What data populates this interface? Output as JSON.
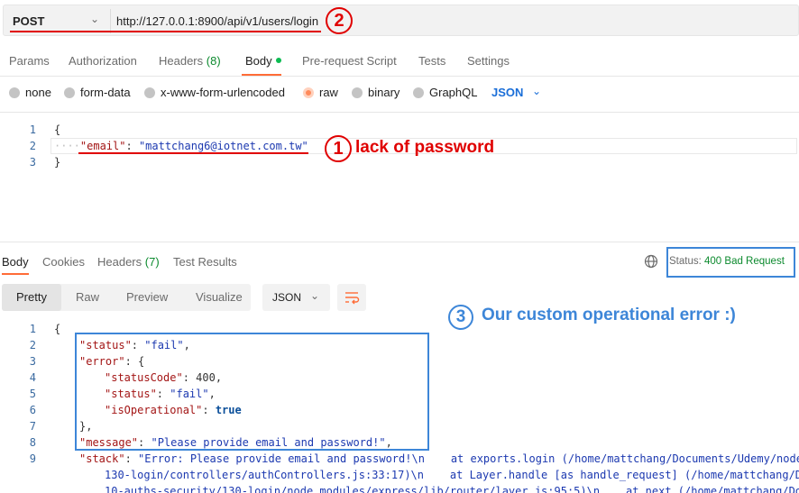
{
  "request": {
    "method": "POST",
    "url": "http://127.0.0.1:8900/api/v1/users/login"
  },
  "annotations": {
    "step1_number": "1",
    "step1_text": "lack of password",
    "step2_number": "2",
    "step3_number": "3",
    "step3_text": "Our custom operational error :)"
  },
  "request_tabs": {
    "params": "Params",
    "authorization": "Authorization",
    "headers": "Headers",
    "headers_count": "(8)",
    "body": "Body",
    "pre_request_script": "Pre-request Script",
    "tests": "Tests",
    "settings": "Settings"
  },
  "body_types": {
    "none": "none",
    "form_data": "form-data",
    "urlencoded": "x-www-form-urlencoded",
    "raw": "raw",
    "binary": "binary",
    "graphql": "GraphQL",
    "language": "JSON"
  },
  "request_body": {
    "line_numbers": [
      "1",
      "2",
      "3"
    ],
    "open_brace": "{",
    "email_key": "\"email\"",
    "email_colon": ": ",
    "email_value": "\"mattchang6@iotnet.com.tw\"",
    "close_brace": "}"
  },
  "response_tabs": {
    "body": "Body",
    "cookies": "Cookies",
    "headers": "Headers",
    "headers_count": "(7)",
    "test_results": "Test Results",
    "status_label": "Status:",
    "status_value": "400 Bad Request"
  },
  "response_view": {
    "pretty": "Pretty",
    "raw": "Raw",
    "preview": "Preview",
    "visualize": "Visualize",
    "format": "JSON"
  },
  "response_body": {
    "line_numbers": [
      "1",
      "2",
      "3",
      "4",
      "5",
      "6",
      "7",
      "8",
      "9"
    ],
    "open_brace": "{",
    "status_key": "\"status\"",
    "status_value": "\"fail\"",
    "error_key": "\"error\"",
    "error_open": "{",
    "status_code_key": "\"statusCode\"",
    "status_code_value": "400",
    "inner_status_key": "\"status\"",
    "inner_status_value": "\"fail\"",
    "is_operational_key": "\"isOperational\"",
    "is_operational_value": "true",
    "error_close": "},",
    "message_key": "\"message\"",
    "message_value": "\"Please provide email and password!\"",
    "stack_key": "\"stack\"",
    "stack_line1": "\"Error: Please provide email and password!\\n    at exports.login (/home/mattchang/Documents/Udemy/node",
    "stack_line2": "130-login/controllers/authControllers.js:33:17)\\n    at Layer.handle [as handle_request] (/home/mattchang/D",
    "stack_line3": "10-auths-security/130-login/node_modules/express/lib/router/layer.js:95:5)\\n    at next (/home/mattchang/Do"
  },
  "colors": {
    "accent_orange": "#ff6c37",
    "annotation_red": "#e00000",
    "annotation_blue": "#3d86d8",
    "status_green": "#0c8a2e",
    "json_blue": "#1a6ed8"
  }
}
